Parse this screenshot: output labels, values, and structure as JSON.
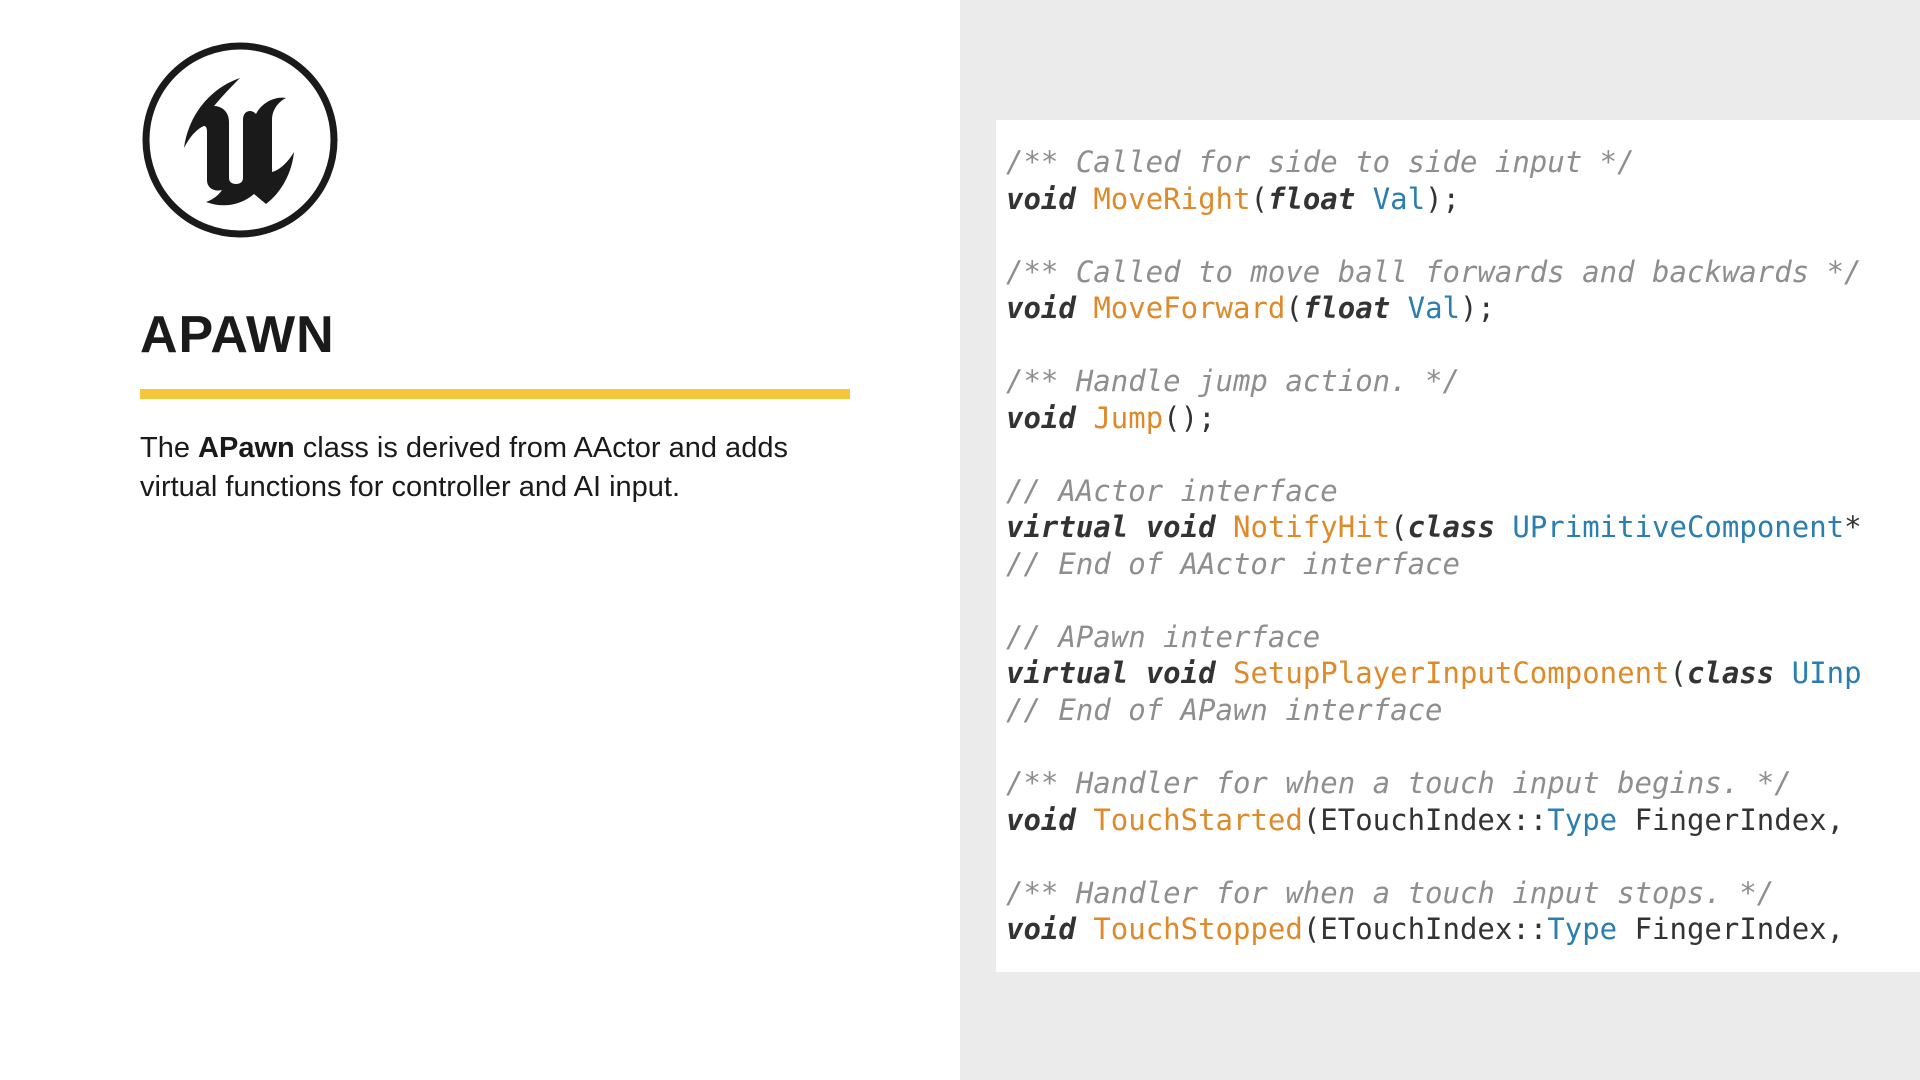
{
  "left": {
    "title": "APAWN",
    "description_prefix": "The ",
    "description_bold": "APawn",
    "description_suffix": " class is derived from AActor and adds virtual functions for controller and AI input."
  },
  "code": {
    "c1": "/** Called for side to side input */",
    "l1_kw": "void",
    "l1_fn": "MoveRight",
    "l1_p1": "(",
    "l1_tkw": "float",
    "l1_arg": " Val",
    "l1_p2": ");",
    "c2": "/** Called to move ball forwards and backwards */",
    "l2_kw": "void",
    "l2_fn": "MoveForward",
    "l2_p1": "(",
    "l2_tkw": "float",
    "l2_arg": " Val",
    "l2_p2": ");",
    "c3": "/** Handle jump action. */",
    "l3_kw": "void",
    "l3_fn": "Jump",
    "l3_p": "();",
    "c4": "// AActor interface",
    "l4_kw1": "virtual",
    "l4_kw2": "void",
    "l4_fn": "NotifyHit",
    "l4_p1": "(",
    "l4_kw3": "class",
    "l4_ty": " UPrimitiveComponent",
    "l4_p2": "*",
    "c5": "// End of AActor interface",
    "c6": "// APawn interface",
    "l5_kw1": "virtual",
    "l5_kw2": "void",
    "l5_fn": "SetupPlayerInputComponent",
    "l5_p1": "(",
    "l5_kw3": "class",
    "l5_ty": " UInp",
    "c7": "// End of APawn interface",
    "c8": "/** Handler for when a touch input begins. */",
    "l6_kw": "void",
    "l6_fn": "TouchStarted",
    "l6_p1": "(",
    "l6_ns": "ETouchIndex::",
    "l6_ty": "Type",
    "l6_arg": " FingerIndex",
    "l6_p2": ",",
    "c9": "/** Handler for when a touch input stops. */",
    "l7_kw": "void",
    "l7_fn": "TouchStopped",
    "l7_p1": "(",
    "l7_ns": "ETouchIndex::",
    "l7_ty": "Type",
    "l7_arg": " FingerIndex",
    "l7_p2": ","
  }
}
